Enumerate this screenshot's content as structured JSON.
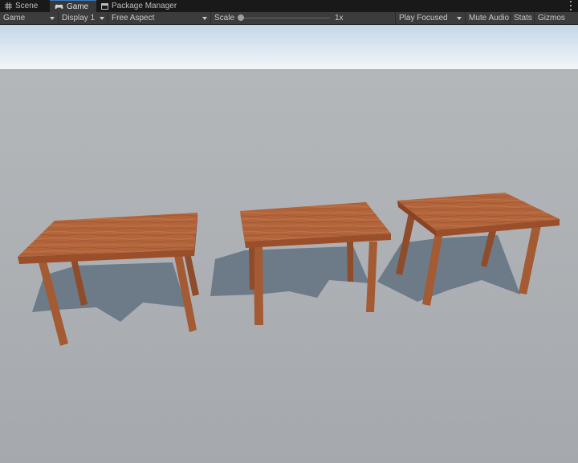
{
  "tabs": [
    {
      "label": "Scene",
      "icon": "grid-icon",
      "active": false
    },
    {
      "label": "Game",
      "icon": "gamepad-icon",
      "active": true
    },
    {
      "label": "Package Manager",
      "icon": "package-icon",
      "active": false
    }
  ],
  "toolbar": {
    "view_mode": "Game",
    "display": "Display 1",
    "aspect": "Free Aspect",
    "scale_label": "Scale",
    "scale_value": "1x",
    "play_mode": "Play Focused",
    "mute_audio": "Mute Audio",
    "stats": "Stats",
    "gizmos": "Gizmos"
  },
  "scene": {
    "objects": [
      "table",
      "table",
      "table"
    ],
    "colors": {
      "sky_top": "#c3d7e8",
      "sky_horizon": "#f2f6fa",
      "ground": "#a9adb1",
      "shadow": "#6d7a87",
      "wood_top": "#b2643b",
      "wood_edge": "#9a4e2a",
      "wood_leg": "#a45a33"
    }
  }
}
